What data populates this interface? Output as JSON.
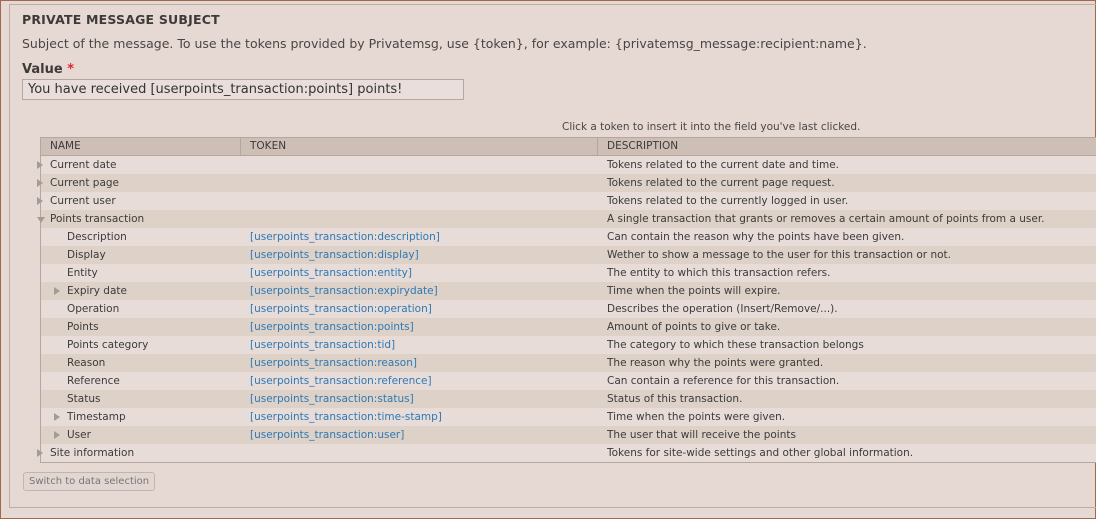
{
  "fieldset": {
    "title": "PRIVATE MESSAGE SUBJECT",
    "description": "Subject of the message. To use the tokens provided by Privatemsg, use {token}, for example: {privatemsg_message:recipient:name}.",
    "value_label": "Value",
    "required_mark": "*",
    "value": "You have received [userpoints_transaction:points] points!"
  },
  "token_browser": {
    "hint": "Click a token to insert it into the field you've last clicked.",
    "columns": [
      "NAME",
      "TOKEN",
      "DESCRIPTION"
    ],
    "rows": [
      {
        "name": "Current date",
        "token": "",
        "description": "Tokens related to the current date and time.",
        "level": 1,
        "expander": "collapsed"
      },
      {
        "name": "Current page",
        "token": "",
        "description": "Tokens related to the current page request.",
        "level": 1,
        "expander": "collapsed"
      },
      {
        "name": "Current user",
        "token": "",
        "description": "Tokens related to the currently logged in user.",
        "level": 1,
        "expander": "collapsed"
      },
      {
        "name": "Points transaction",
        "token": "",
        "description": "A single transaction that grants or removes a certain amount of points from a user.",
        "level": 1,
        "expander": "expanded"
      },
      {
        "name": "Description",
        "token": "[userpoints_transaction:description]",
        "description": "Can contain the reason why the points have been given.",
        "level": 2,
        "expander": ""
      },
      {
        "name": "Display",
        "token": "[userpoints_transaction:display]",
        "description": "Wether to show a message to the user for this transaction or not.",
        "level": 2,
        "expander": ""
      },
      {
        "name": "Entity",
        "token": "[userpoints_transaction:entity]",
        "description": "The entity to which this transaction refers.",
        "level": 2,
        "expander": ""
      },
      {
        "name": "Expiry date",
        "token": "[userpoints_transaction:expirydate]",
        "description": "Time when the points will expire.",
        "level": 2,
        "expander": "collapsed"
      },
      {
        "name": "Operation",
        "token": "[userpoints_transaction:operation]",
        "description": "Describes the operation (Insert/Remove/...).",
        "level": 2,
        "expander": ""
      },
      {
        "name": "Points",
        "token": "[userpoints_transaction:points]",
        "description": "Amount of points to give or take.",
        "level": 2,
        "expander": ""
      },
      {
        "name": "Points category",
        "token": "[userpoints_transaction:tid]",
        "description": "The category to which these transaction belongs",
        "level": 2,
        "expander": ""
      },
      {
        "name": "Reason",
        "token": "[userpoints_transaction:reason]",
        "description": "The reason why the points were granted.",
        "level": 2,
        "expander": ""
      },
      {
        "name": "Reference",
        "token": "[userpoints_transaction:reference]",
        "description": "Can contain a reference for this transaction.",
        "level": 2,
        "expander": ""
      },
      {
        "name": "Status",
        "token": "[userpoints_transaction:status]",
        "description": "Status of this transaction.",
        "level": 2,
        "expander": ""
      },
      {
        "name": "Timestamp",
        "token": "[userpoints_transaction:time-stamp]",
        "description": "Time when the points were given.",
        "level": 2,
        "expander": "collapsed"
      },
      {
        "name": "User",
        "token": "[userpoints_transaction:user]",
        "description": "The user that will receive the points",
        "level": 2,
        "expander": "collapsed"
      },
      {
        "name": "Site information",
        "token": "",
        "description": "Tokens for site-wide settings and other global information.",
        "level": 1,
        "expander": "collapsed"
      }
    ]
  },
  "switch_button": "Switch to data selection"
}
